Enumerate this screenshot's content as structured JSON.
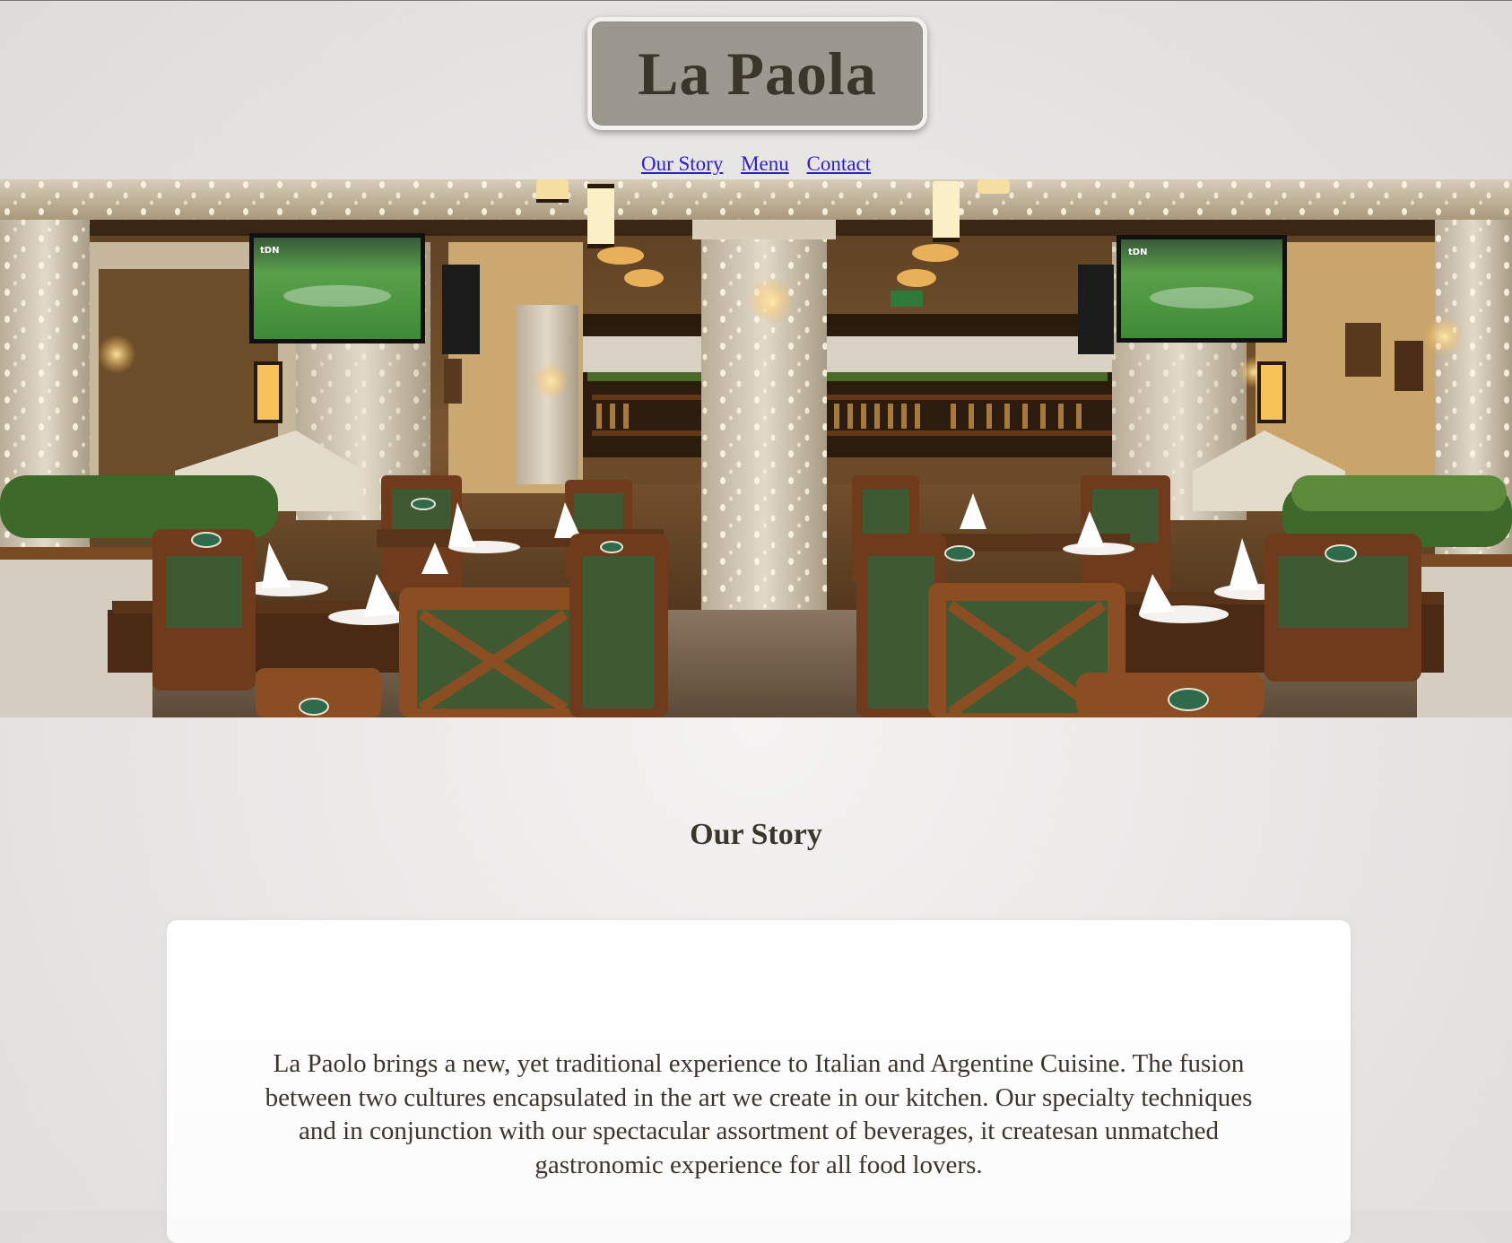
{
  "header": {
    "logo_text": "La Paola"
  },
  "nav": {
    "items": [
      {
        "label": "Our Story"
      },
      {
        "label": "Menu"
      },
      {
        "label": "Contact"
      }
    ]
  },
  "hero": {
    "tv_badge": "tDN"
  },
  "story": {
    "title": "Our Story",
    "body": "La Paolo brings a new, yet traditional experience to Italian and Argentine Cuisine. The fusion between two cultures encapsulated in the art we create in our kitchen. Our specialty techniques and in conjunction with our spectacular assortment of beverages, it createsan unmatched gastronomic experience for all food lovers."
  },
  "colors": {
    "page_bg": "#e8e6e5",
    "logo_bg": "#9c9890",
    "logo_text": "#3b352c",
    "link": "#2a1fd0",
    "card_bg": "#ffffff"
  }
}
